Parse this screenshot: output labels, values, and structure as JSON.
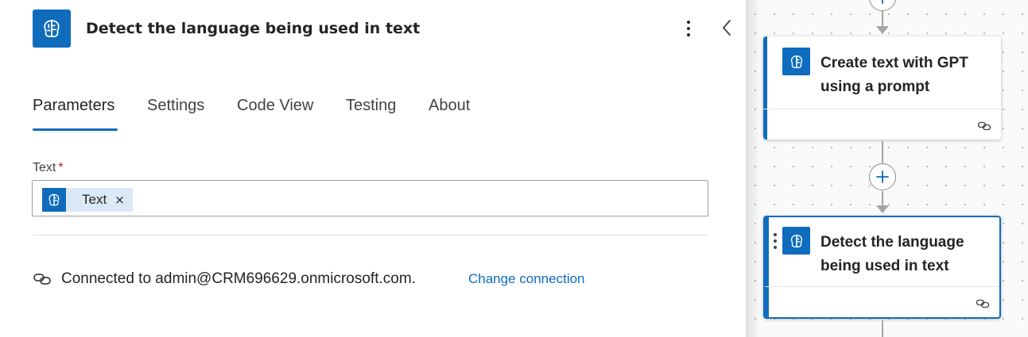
{
  "panel": {
    "title": "Detect the language being used in text",
    "header_icon": "ai-brain-icon",
    "tabs": [
      {
        "label": "Parameters",
        "active": true
      },
      {
        "label": "Settings",
        "active": false
      },
      {
        "label": "Code View",
        "active": false
      },
      {
        "label": "Testing",
        "active": false
      },
      {
        "label": "About",
        "active": false
      }
    ],
    "field": {
      "label": "Text",
      "required_mark": "*",
      "token": {
        "label": "Text",
        "remove": "×"
      }
    },
    "connection": {
      "text": "Connected to admin@CRM696629.onmicrosoft.com.",
      "link": "Change connection"
    }
  },
  "canvas": {
    "cards": [
      {
        "title": "Create text with GPT using a prompt",
        "selected": false
      },
      {
        "title": "Detect the language being used in text",
        "selected": true
      }
    ]
  },
  "colors": {
    "accent": "#0F6CBD",
    "required": "#C50F1F",
    "token_bg": "#DBE9F7",
    "connector": "#A6A6A6"
  }
}
